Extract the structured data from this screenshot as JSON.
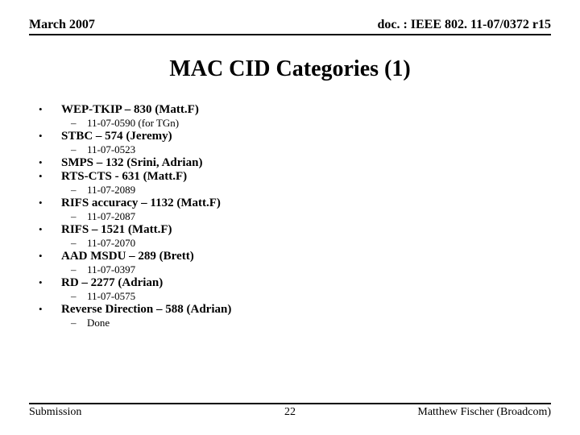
{
  "header": {
    "left": "March 2007",
    "right": "doc. : IEEE 802. 11-07/0372 r15"
  },
  "title": "MAC CID Categories (1)",
  "items": [
    {
      "text": "WEP-TKIP – 830 (Matt.F)",
      "sub": "11-07-0590 (for TGn)"
    },
    {
      "text": "STBC – 574 (Jeremy)",
      "sub": "11-07-0523"
    },
    {
      "text": "SMPS – 132 (Srini, Adrian)",
      "sub": null
    },
    {
      "text": "RTS-CTS - 631 (Matt.F)",
      "sub": "11-07-2089"
    },
    {
      "text": "RIFS accuracy – 1132 (Matt.F)",
      "sub": "11-07-2087"
    },
    {
      "text": "RIFS – 1521 (Matt.F)",
      "sub": "11-07-2070"
    },
    {
      "text": "AAD MSDU – 289 (Brett)",
      "sub": "11-07-0397"
    },
    {
      "text": "RD – 2277 (Adrian)",
      "sub": "11-07-0575"
    },
    {
      "text": "Reverse Direction – 588 (Adrian)",
      "sub": "Done"
    }
  ],
  "footer": {
    "left": "Submission",
    "center": "22",
    "right": "Matthew Fischer (Broadcom)"
  }
}
